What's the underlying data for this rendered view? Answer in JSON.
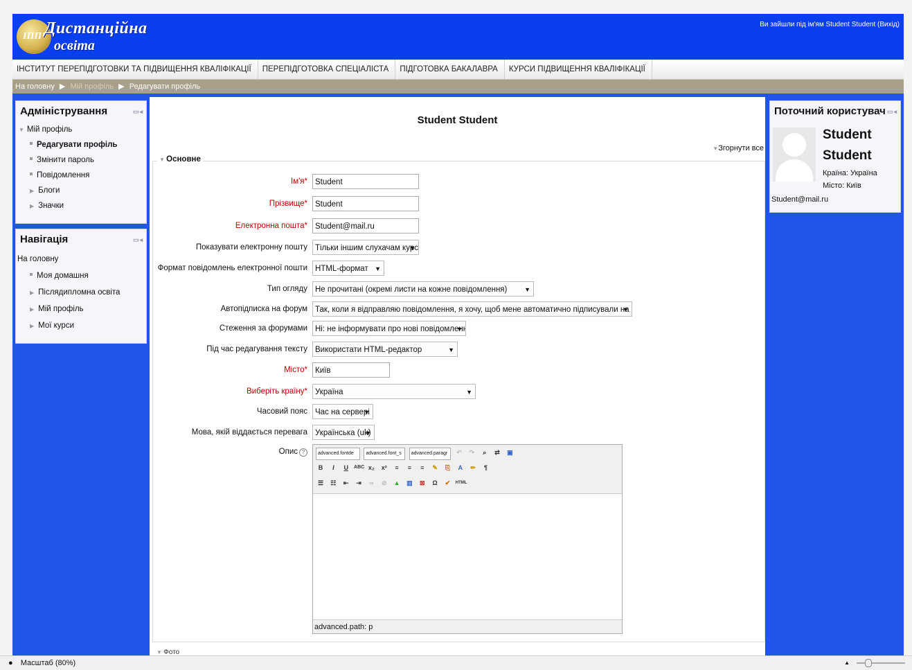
{
  "header": {
    "logo_line1": "Дистанційна",
    "logo_line2": "освіта",
    "logo_mark": "ІПП",
    "login_prefix": "Ви зайшли під ім'ям Student Student",
    "logout_label": "(Вихід)"
  },
  "topnav": [
    "ІНСТИТУТ ПЕРЕПІДГОТОВКИ ТА ПІДВИЩЕННЯ КВАЛІФІКАЦІЇ",
    "ПЕРЕПІДГОТОВКА СПЕЦІАЛІСТА",
    "ПІДГОТОВКА БАКАЛАВРА",
    "КУРСИ ПІДВИЩЕННЯ КВАЛІФІКАЦІЇ"
  ],
  "breadcrumb": {
    "home": "На головну",
    "sep": "▶",
    "profile": "Мій профіль",
    "current": "Редагувати профіль"
  },
  "admin_block": {
    "title": "Адміністрування",
    "controls": "▭◂",
    "my_profile": "Мій профіль",
    "items": [
      "Редагувати профіль",
      "Змінити пароль",
      "Повідомлення"
    ],
    "expandable": [
      "Блоги",
      "Значки"
    ]
  },
  "nav_block": {
    "title": "Навігація",
    "controls": "▭◂",
    "home": "На головну",
    "my_home": "Моя домашня",
    "expandable": [
      "Післядипломна освіта",
      "Мій профіль",
      "Мої курси"
    ]
  },
  "main": {
    "title": "Student Student",
    "collapse_all": "Згорнути все",
    "section": "Основне",
    "next_section": "Фото",
    "fields": {
      "firstname_label": "Ім'я*",
      "firstname": "Student",
      "lastname_label": "Прізвище*",
      "lastname": "Student",
      "email_label": "Електронна пошта*",
      "email": "Student@mail.ru",
      "maildisplay_label": "Показувати електронну пошту",
      "maildisplay": "Тільки іншим слухачам курсу",
      "mailformat_label": "Формат повідомлень електронної пошти",
      "mailformat": "HTML-формат",
      "digest_label": "Тип огляду",
      "digest": "Не прочитані (окремі листи на кожне повідомлення)",
      "autosub_label": "Автопідписка на форум",
      "autosub": "Так, коли я відправляю повідомлення, я хочу, щоб мене автоматично підписували на форум",
      "tracking_label": "Стеження за форумами",
      "tracking": "Ні: не інформувати про нові повідомлення",
      "editor_label": "Під час редагування тексту",
      "editor": "Використати HTML-редактор",
      "city_label": "Місто*",
      "city": "Київ",
      "country_label": "Виберіть країну*",
      "country": "Україна",
      "timezone_label": "Часовий пояс",
      "timezone": "Час на сервері",
      "lang_label": "Мова, якій віддається перевага",
      "lang": "Українська (uk)",
      "desc_label": "Опис"
    },
    "editor_toolbar": {
      "sel1": "advanced.fontde",
      "sel2": "advanced.font_s",
      "sel3": "advanced.paragr",
      "status": "advanced.path: p"
    }
  },
  "user_block": {
    "title": "Поточний користувач",
    "controls": "▭◂",
    "name_first": "Student",
    "name_last": "Student",
    "country": "Країна: Україна",
    "city": "Місто: Київ",
    "email": "Student@mail.ru"
  },
  "statusbar": {
    "zoom": "Масштаб (80%)"
  }
}
